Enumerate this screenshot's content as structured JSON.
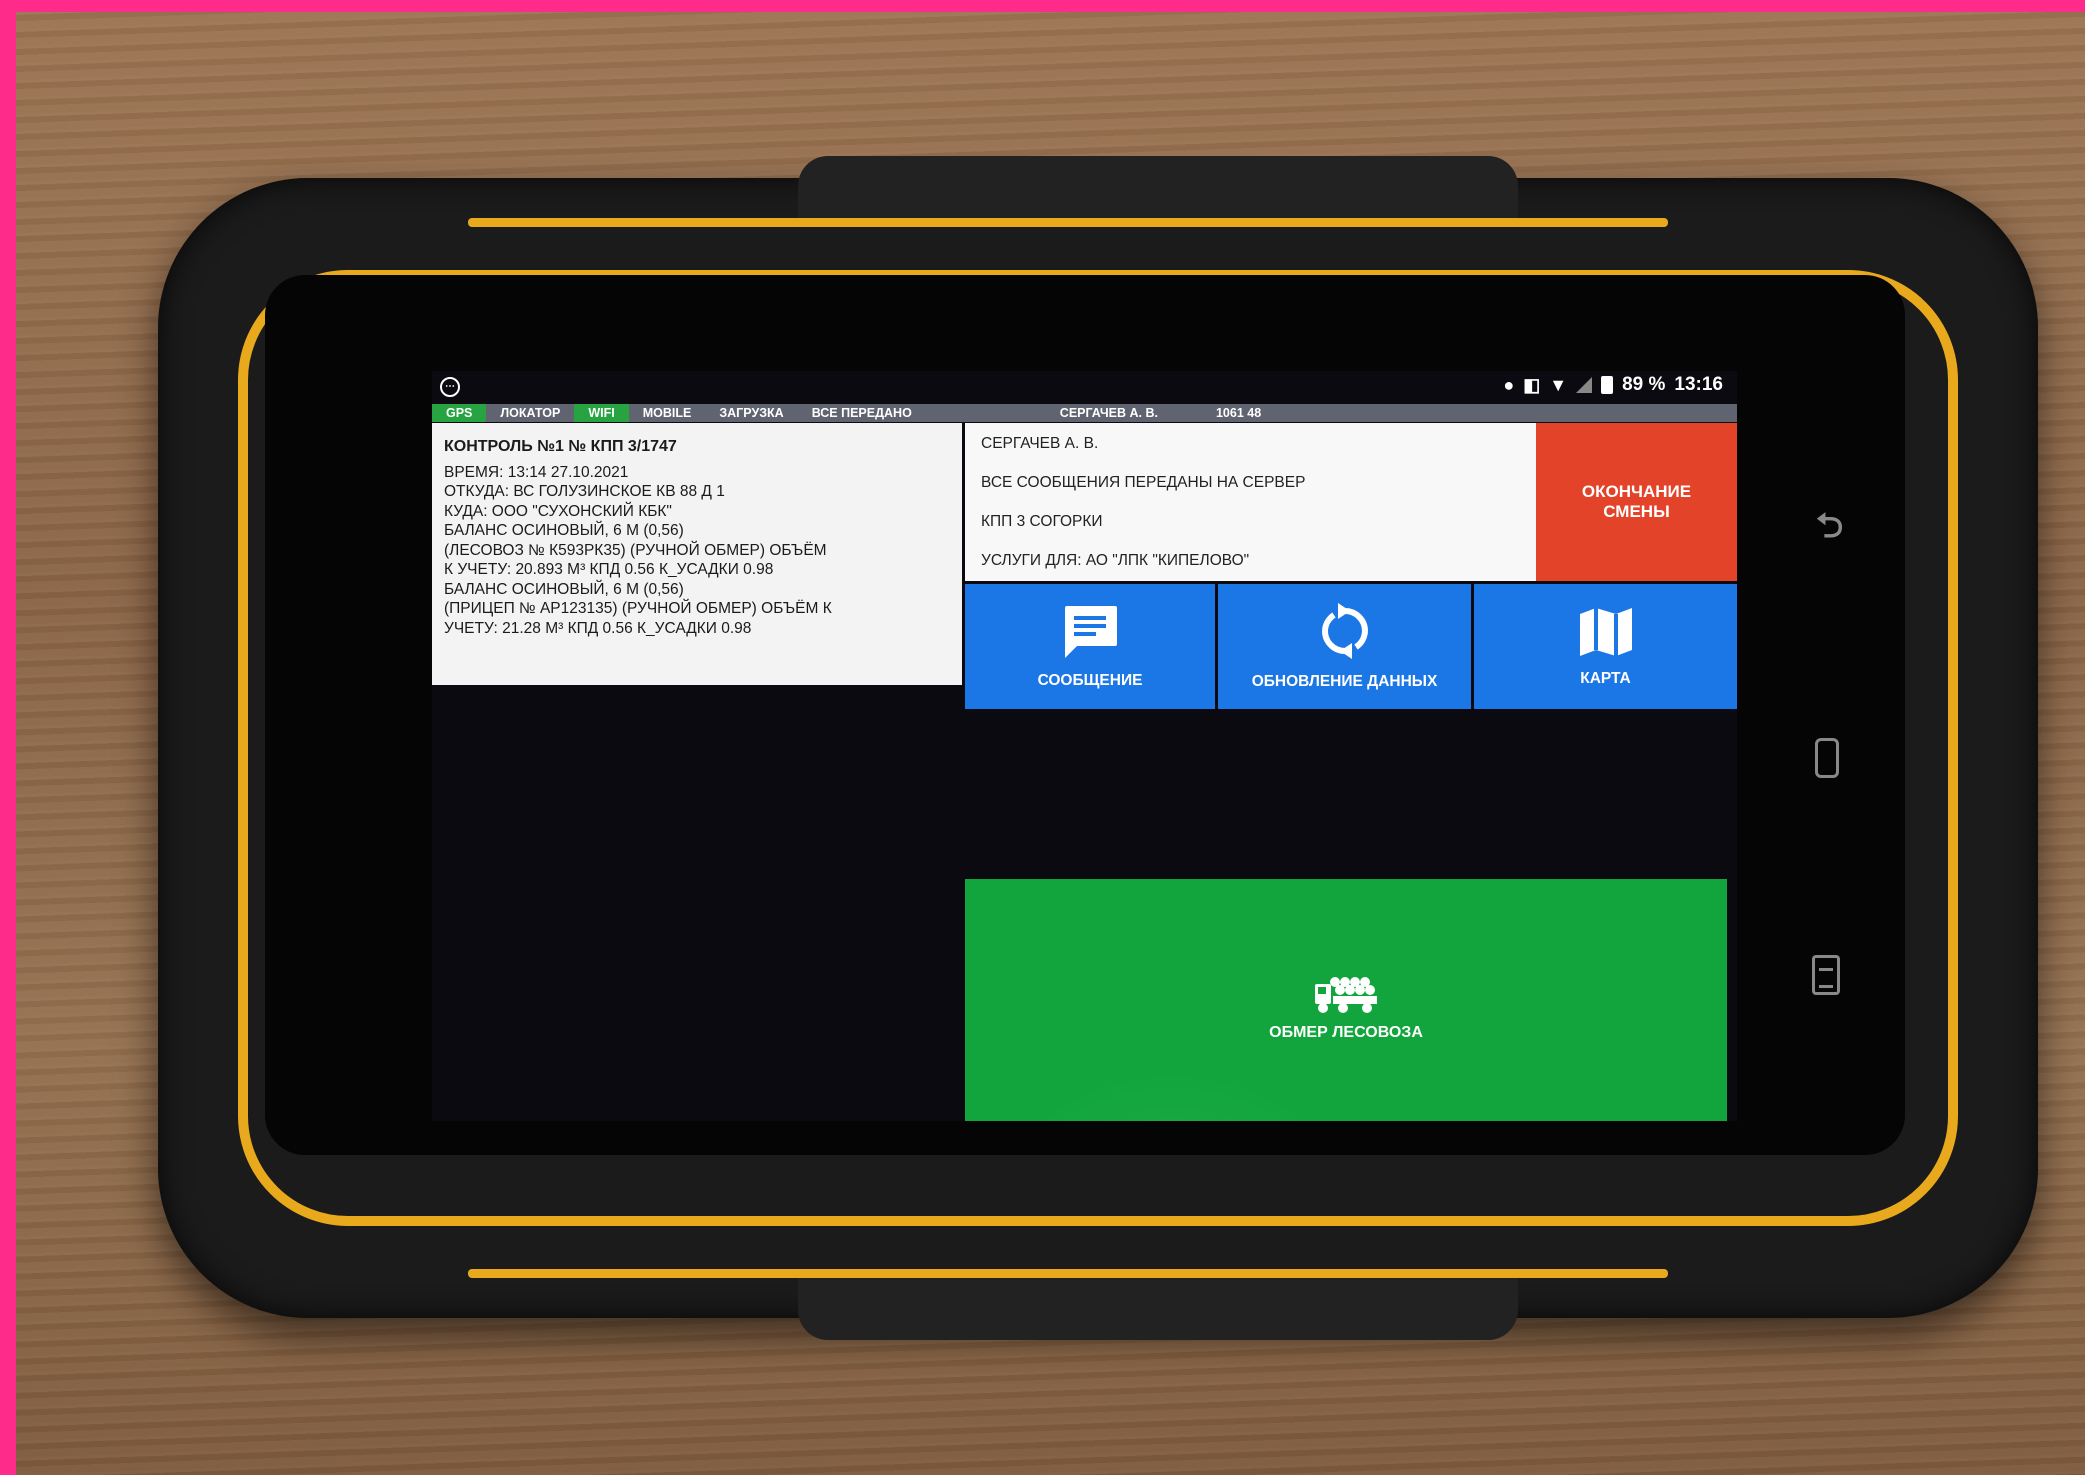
{
  "status_bar": {
    "battery": "89 %",
    "time": "13:16",
    "icons": [
      "location-icon",
      "vibrate-icon",
      "wifi-icon",
      "signal-icon",
      "battery-icon"
    ],
    "notification_icon": "chat-bubble-icon"
  },
  "indicators": {
    "items": [
      {
        "label": "GPS",
        "active": true
      },
      {
        "label": "ЛОКАТОР",
        "active": false
      },
      {
        "label": "WIFI",
        "active": true
      },
      {
        "label": "MOBILE",
        "active": false
      },
      {
        "label": "ЗАГРУЗКА",
        "active": false
      },
      {
        "label": "ВСЕ ПЕРЕДАНО",
        "active": false
      }
    ],
    "user": "СЕРГАЧЕВ А. В.",
    "code": "1061 48",
    "active_color": "#27a342",
    "bar_color": "#5f6470"
  },
  "info_panel": {
    "title": "КОНТРОЛЬ №1  № КПП 3/1747",
    "lines": [
      "ВРЕМЯ: 13:14 27.10.2021",
      "ОТКУДА: ВС ГОЛУЗИНСКОЕ КВ 88 Д 1",
      "КУДА: ООО \"СУХОНСКИЙ КБК\"",
      "БАЛАНС ОСИНОВЫЙ, 6 М (0,56)",
      " (ЛЕСОВОЗ № К593РК35) (РУЧНОЙ ОБМЕР) ОБЪЁМ",
      "К УЧЕТУ: 20.893 М³  КПД 0.56  К_УСАДКИ 0.98",
      "БАЛАНС ОСИНОВЫЙ, 6 М (0,56)",
      " (ПРИЦЕП № АР123135) (РУЧНОЙ ОБМЕР) ОБЪЁМ К",
      "УЧЕТУ: 21.28 М³  КПД 0.56  К_УСАДКИ 0.98"
    ]
  },
  "messages": {
    "lines": [
      "СЕРГАЧЕВ  А. В.",
      "ВСЕ СООБЩЕНИЯ ПЕРЕДАНЫ НА СЕРВЕР",
      "КПП 3 СОГОРКИ",
      "УСЛУГИ ДЛЯ: АО \"ЛПК \"КИПЕЛОВО\""
    ]
  },
  "buttons": {
    "shift_end_line1": "ОКОНЧАНИЕ",
    "shift_end_line2": "СМЕНЫ",
    "shift_end_color": "#e34328",
    "message": "СООБЩЕНИЕ",
    "update": "ОБНОВЛЕНИЕ ДАННЫХ",
    "map": "КАРТА",
    "tile_color": "#1b76e6",
    "measure": "ОБМЕР ЛЕСОВОЗА",
    "measure_color": "#12a53d"
  }
}
